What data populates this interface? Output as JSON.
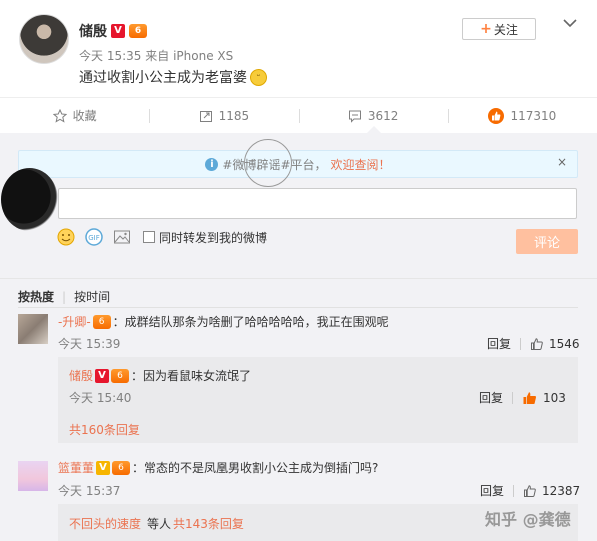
{
  "post": {
    "author": "储殷",
    "badge_v": "V",
    "rank_badge": "6",
    "time": "今天 15:35",
    "source_prefix": "来自",
    "source": "iPhone XS",
    "text": "通过收割小公主成为老富婆",
    "follow_label": "关注"
  },
  "actions": {
    "favorite": "收藏",
    "repost": "1185",
    "comment": "3612",
    "like": "117310"
  },
  "notice": {
    "prefix": "#微博辟谣#平台，",
    "link": "欢迎查阅！",
    "close": "×"
  },
  "composer": {
    "repost_option": "同时转发到我的微博",
    "submit": "评论"
  },
  "sort": {
    "hot": "按热度",
    "time": "按时间"
  },
  "comments": [
    {
      "user": "-升卿-",
      "text": "：成群结队那条为啥删了哈哈哈哈哈，我正在围观呢",
      "time": "今天 15:39",
      "reply_label": "回复",
      "likes": "1546",
      "reply": {
        "user": "储殷",
        "text": "：因为看鼠味女流氓了",
        "time": "今天 15:40",
        "reply_label": "回复",
        "likes": "103"
      },
      "more": "共160条回复"
    },
    {
      "user": "篮董董",
      "text": "：常态的不是凤凰男收割小公主成为倒插门吗?",
      "time": "今天 15:37",
      "reply_label": "回复",
      "likes": "12387",
      "sub_user": "不回头的速度",
      "sub_mid": "等人",
      "more": "共143条回复"
    }
  ],
  "watermark": "知乎 @龚德",
  "colors": {
    "accent": "#eb7350",
    "liked": "#f76b00",
    "submit_disabled": "#ffc09f"
  }
}
